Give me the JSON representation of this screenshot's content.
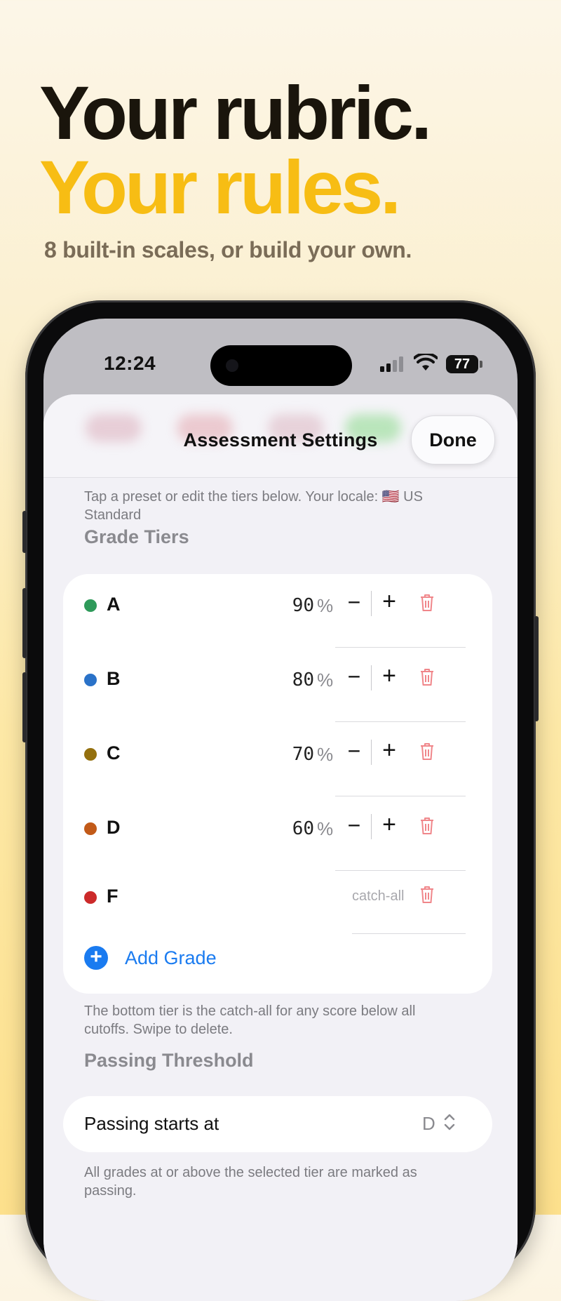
{
  "headline": {
    "line1": "Your rubric.",
    "line2": "Your rules.",
    "subtitle": "8 built-in scales, or build your own."
  },
  "status_bar": {
    "time": "12:24",
    "battery": "77"
  },
  "sheet": {
    "title": "Assessment Settings",
    "done_label": "Done",
    "hint": "Tap a preset or edit the tiers below. Your locale: 🇺🇸 US Standard",
    "grade_tiers_heading": "Grade Tiers",
    "tiers": [
      {
        "letter": "A",
        "cutoff": "90",
        "unit": "%",
        "color": "#2e9a5a"
      },
      {
        "letter": "B",
        "cutoff": "80",
        "unit": "%",
        "color": "#2a72c8"
      },
      {
        "letter": "C",
        "cutoff": "70",
        "unit": "%",
        "color": "#94700e"
      },
      {
        "letter": "D",
        "cutoff": "60",
        "unit": "%",
        "color": "#c25a18"
      },
      {
        "letter": "F",
        "cutoff_label": "catch-all",
        "color": "#cc2a2a"
      }
    ],
    "add_grade_label": "Add Grade",
    "tiers_footer": "The bottom tier is the catch-all for any score below all cutoffs. Swipe to delete.",
    "passing_heading": "Passing Threshold",
    "passing_label": "Passing starts at",
    "passing_value": "D",
    "passing_footer": "All grades at or above the selected tier are marked as passing."
  },
  "colors": {
    "accent": "#1a7bf0",
    "headline_gold": "#f7bd14",
    "trash": "#f0868a"
  }
}
